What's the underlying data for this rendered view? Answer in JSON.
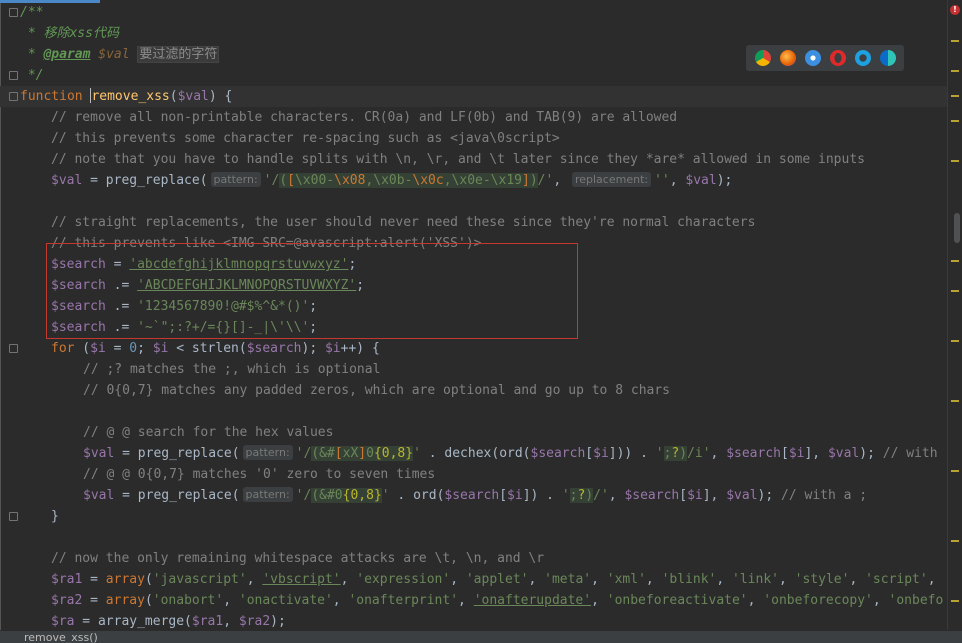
{
  "doc_comment": {
    "open": "/**",
    "desc": " * 移除xss代码",
    "param_tag": "@param",
    "param_var": "$val",
    "param_desc": "要过滤的字符",
    "close": " */"
  },
  "function": {
    "keyword": "function",
    "name": "remove_xss",
    "param": "$val",
    "open": ") {"
  },
  "comments": {
    "c1": "// remove all non-printable characters. CR(0a) and LF(0b) and TAB(9) are allowed",
    "c2": "// this prevents some character re-spacing such as <java\\0script>",
    "c3": "// note that you have to handle splits with \\n, \\r, and \\t later since they *are* allowed in some inputs",
    "c4": "// straight replacements, the user should never need these since they're normal characters",
    "c5": "// this prevents like <IMG SRC=@avascript:alert('XSS')>",
    "c6": "// ;? matches the ;, which is optional",
    "c7": "// 0{0,7} matches any padded zeros, which are optional and go up to 8 chars",
    "c8": "// @ @ search for the hex values",
    "c9": "// @ @ 0{0,7} matches '0' zero to seven times",
    "c10": "// now the only remaining whitespace attacks are \\t, \\n, and \\r"
  },
  "hints": {
    "pattern": "pattern:",
    "replacement": "replacement:"
  },
  "search_strings": {
    "s1": "'abcdefghijklmnopqrstuvwxyz'",
    "s2": "'ABCDEFGHIJKLMNOPQRSTUVWXYZ'",
    "s3": "'1234567890!@#$%^&*()'",
    "s4": "'~`\";:?+/={}[]-_|\\'\\\\'"
  },
  "browsers": [
    "chrome-icon",
    "firefox-icon",
    "safari-icon",
    "opera-icon",
    "ie-icon",
    "edge-icon"
  ],
  "status_text": "remove_xss()"
}
